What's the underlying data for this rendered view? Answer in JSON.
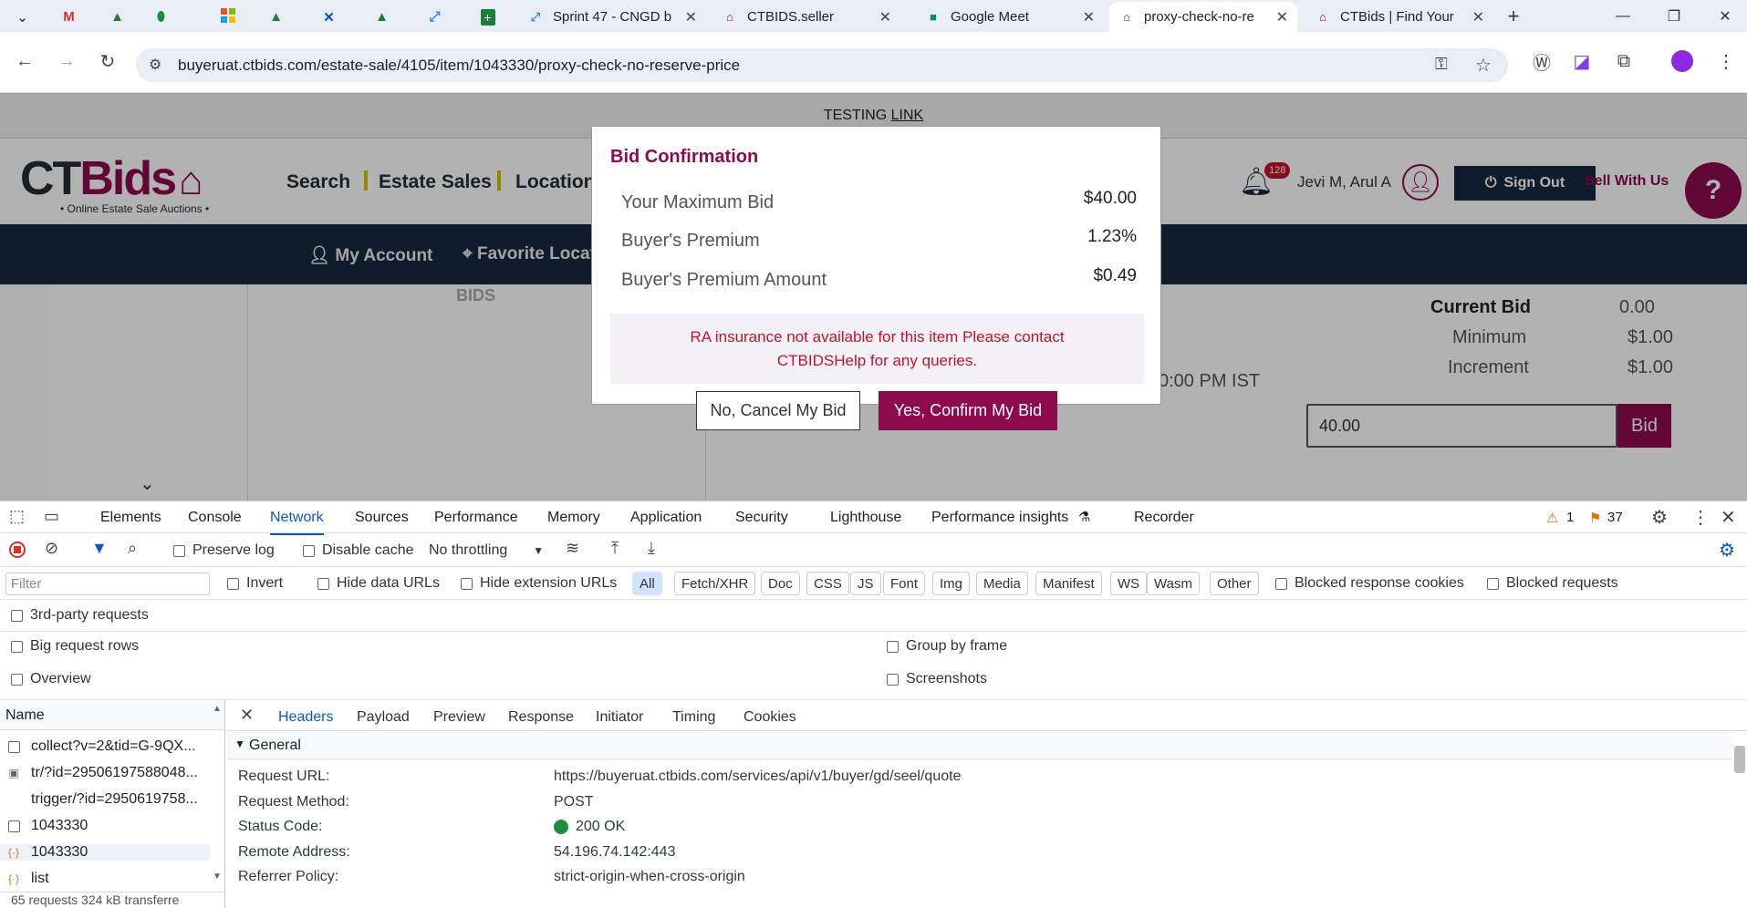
{
  "browser": {
    "tabs": [
      {
        "title": "",
        "icon": "chevron-down-icon"
      },
      {
        "title": "",
        "icon": "gmail-icon"
      },
      {
        "title": "",
        "icon": "google-drive-icon"
      },
      {
        "title": "",
        "icon": "leaf-icon"
      },
      {
        "title": "",
        "icon": "microsoft-icon"
      },
      {
        "title": "",
        "icon": "google-drive-icon"
      },
      {
        "title": "",
        "icon": "confluence-icon"
      },
      {
        "title": "",
        "icon": "google-drive-icon"
      },
      {
        "title": "",
        "icon": "jira-icon"
      },
      {
        "title": "",
        "icon": "google-sheets-icon"
      },
      {
        "title": "Sprint 47 - CNGD b",
        "icon": "jira-icon"
      },
      {
        "title": "CTBIDS.seller",
        "icon": "ctbids-icon"
      },
      {
        "title": "Google Meet",
        "icon": "google-meet-icon"
      },
      {
        "title": "proxy-check-no-re",
        "icon": "ctbids-icon"
      },
      {
        "title": "CTBids | Find Your",
        "icon": "ctbids-icon"
      }
    ],
    "new_tab": "+",
    "url": "buyeruat.ctbids.com/estate-sale/4105/item/1043330/proxy-check-no-reserve-price"
  },
  "site": {
    "testing_banner_prefix": "TESTING ",
    "testing_banner_link": "LINK",
    "logo_text_ct": "CT",
    "logo_text_bids": "Bids",
    "tagline": "• Online Estate Sale Auctions •",
    "nav": [
      "Search",
      "Estate Sales",
      "Location"
    ],
    "notification_count": "128",
    "user_name": "Jevi M, Arul A",
    "sign_out": "Sign Out",
    "sell_with_us": "Sell With Us",
    "subnav": [
      "My Account",
      "Favorite Locat"
    ],
    "bids_watermark": "BIDS",
    "auction_time": "0:00 PM IST",
    "current_bid_label": "Current Bid",
    "current_bid_value": "0.00",
    "minimum_label": "Minimum",
    "minimum_value": "$1.00",
    "increment_label": "Increment",
    "increment_value": "$1.00",
    "bid_input_value": "40.00",
    "bid_button": "Bid"
  },
  "modal": {
    "title": "Bid Confirmation",
    "rows": [
      {
        "label": "Your Maximum Bid",
        "value": "$40.00"
      },
      {
        "label": "Buyer's Premium",
        "value": "1.23%"
      },
      {
        "label": "Buyer's Premium Amount",
        "value": "$0.49"
      }
    ],
    "alert_line1": "RA insurance not available for this item Please contact",
    "alert_line2": "CTBIDSHelp for any queries.",
    "cancel_button": "No, Cancel My Bid",
    "confirm_button": "Yes, Confirm My Bid"
  },
  "devtools": {
    "tabs": [
      "Elements",
      "Console",
      "Network",
      "Sources",
      "Performance",
      "Memory",
      "Application",
      "Security",
      "Lighthouse",
      "Performance insights",
      "Recorder"
    ],
    "warning_count": "1",
    "issue_count": "37",
    "preserve_log": "Preserve log",
    "disable_cache": "Disable cache",
    "throttling": "No throttling",
    "filter_placeholder": "Filter",
    "invert": "Invert",
    "hide_data_urls": "Hide data URLs",
    "hide_extension_urls": "Hide extension URLs",
    "type_filters": [
      "All",
      "Fetch/XHR",
      "Doc",
      "CSS",
      "JS",
      "Font",
      "Img",
      "Media",
      "Manifest",
      "WS",
      "Wasm",
      "Other"
    ],
    "blocked_response_cookies": "Blocked response cookies",
    "blocked_requests": "Blocked requests",
    "third_party": "3rd-party requests",
    "big_request_rows": "Big request rows",
    "group_by_frame": "Group by frame",
    "overview": "Overview",
    "screenshots": "Screenshots",
    "name_header": "Name",
    "requests": [
      {
        "name": "collect?v=2&tid=G-9QX...",
        "icon": "checkbox-icon"
      },
      {
        "name": "tr/?id=29506197588048...",
        "icon": "image-icon"
      },
      {
        "name": "trigger/?id=2950619758...",
        "icon": "none"
      },
      {
        "name": "1043330",
        "icon": "checkbox-icon"
      },
      {
        "name": "1043330",
        "icon": "xhr-icon"
      },
      {
        "name": "list",
        "icon": "xhr-icon"
      }
    ],
    "status_bar": "65 requests   324 kB transferre",
    "detail_tabs": [
      "Headers",
      "Payload",
      "Preview",
      "Response",
      "Initiator",
      "Timing",
      "Cookies"
    ],
    "general_label": "General",
    "headers": [
      {
        "key": "Request URL:",
        "value": "https://buyeruat.ctbids.com/services/api/v1/buyer/gd/seel/quote"
      },
      {
        "key": "Request Method:",
        "value": "POST"
      },
      {
        "key": "Status Code:",
        "value": "200 OK"
      },
      {
        "key": "Remote Address:",
        "value": "54.196.74.142:443"
      },
      {
        "key": "Referrer Policy:",
        "value": "strict-origin-when-cross-origin"
      }
    ],
    "status_color": "#1e8e3e"
  },
  "colors": {
    "brand": "#8d0a4d",
    "navy": "#16293e",
    "devtools_accent": "#0b57d0"
  }
}
